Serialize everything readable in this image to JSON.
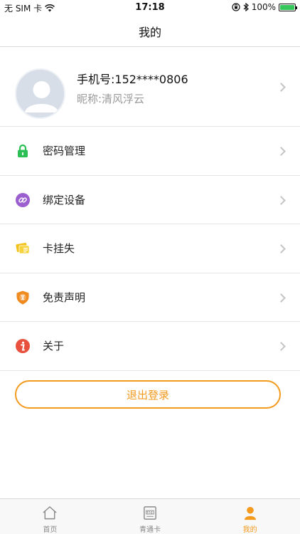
{
  "status_bar": {
    "carrier": "无 SIM 卡",
    "time": "17:18",
    "battery": "100%"
  },
  "nav": {
    "title": "我的"
  },
  "profile": {
    "phone": "手机号:152****0806",
    "nickname": "昵称:清风浮云"
  },
  "menu": {
    "items": [
      {
        "label": "密码管理",
        "icon": "lock-icon"
      },
      {
        "label": "绑定设备",
        "icon": "link-icon"
      },
      {
        "label": "卡挂失",
        "icon": "card-loss-icon"
      },
      {
        "label": "免责声明",
        "icon": "disclaimer-shield-icon"
      },
      {
        "label": "关于",
        "icon": "info-icon"
      }
    ]
  },
  "logout": {
    "label": "退出登录"
  },
  "tab_bar": {
    "tabs": [
      {
        "label": "首页",
        "icon": "home-icon"
      },
      {
        "label": "青通卡",
        "icon": "etc-card-icon"
      },
      {
        "label": "我的",
        "icon": "person-icon"
      }
    ]
  },
  "colors": {
    "accent": "#f39a1f",
    "lock_green": "#2cbf55",
    "link_purple": "#9b5fd0",
    "card_yellow": "#f2c21a",
    "shield_orange": "#f08a1e",
    "info_red": "#e8513d"
  }
}
